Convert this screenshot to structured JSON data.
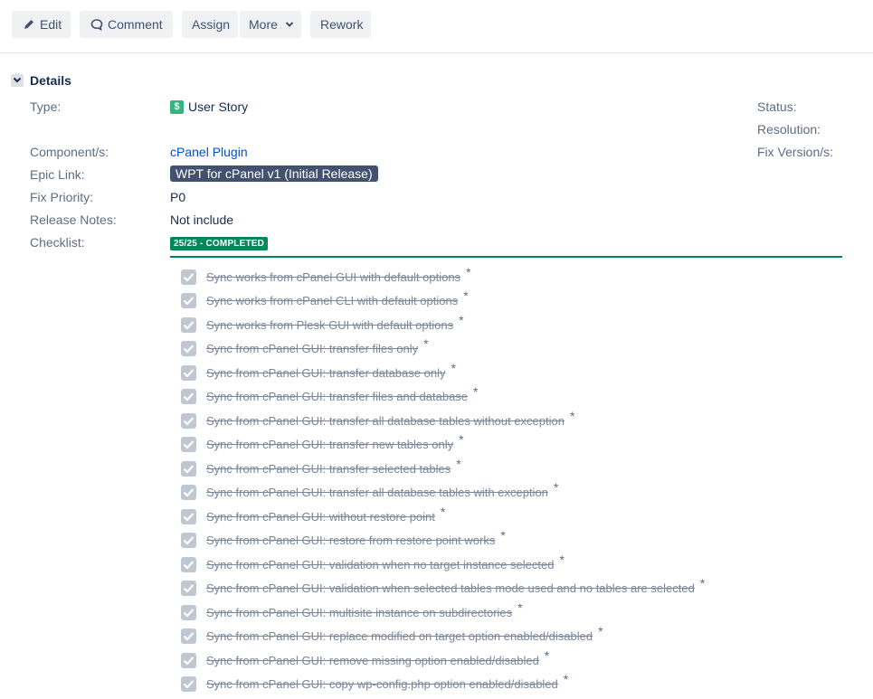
{
  "toolbar": {
    "edit_label": "Edit",
    "comment_label": "Comment",
    "assign_label": "Assign",
    "more_label": "More",
    "rework_label": "Rework"
  },
  "details": {
    "title": "Details",
    "type_label": "Type:",
    "type_value": "User Story",
    "type_icon_char": "$",
    "component_label": "Component/s:",
    "component_value": "cPanel Plugin",
    "epic_label": "Epic Link:",
    "epic_value": "WPT for cPanel v1 (Initial Release)",
    "fix_priority_label": "Fix Priority:",
    "fix_priority_value": "P0",
    "release_notes_label": "Release Notes:",
    "release_notes_value": "Not include",
    "checklist_label": "Checklist:",
    "status_label": "Status:",
    "resolution_label": "Resolution:",
    "fix_version_label": "Fix Version/s:"
  },
  "checklist": {
    "progress_text": "25/25 - COMPLETED",
    "star": "*",
    "items": [
      "Sync works from cPanel GUI with default options",
      "Sync works from cPanel CLI with default options",
      "Sync works from Plesk GUI with default options",
      "Sync from cPanel GUI: transfer files only",
      "Sync from cPanel GUI: transfer database only",
      "Sync from cPanel GUI: transfer files and database",
      "Sync from cPanel GUI: transfer all database tables without exception",
      "Sync from cPanel GUI: transfer new tables only",
      "Sync from cPanel GUI: transfer selected tables",
      "Sync from cPanel GUI: transfer all database tables with exception",
      "Sync from cPanel GUI: without restore point",
      "Sync from cPanel GUI: restore from restore point works",
      "Sync from cPanel GUI: validation when no target instance selected",
      "Sync from cPanel GUI: validation when selected tables mode used and no tables are selected",
      "Sync from cPanel GUI: multisite instance on subdirectories",
      "Sync from cPanel GUI: replace modified on target option enabled/disabled",
      "Sync from cPanel GUI: remove missing option enabled/disabled",
      "Sync from cPanel GUI: copy wp-config.php option enabled/disabled"
    ]
  },
  "colors": {
    "completed_green": "#00875a",
    "epic_bg": "#42526e",
    "link_blue": "#0052cc",
    "story_green": "#36b37e"
  }
}
